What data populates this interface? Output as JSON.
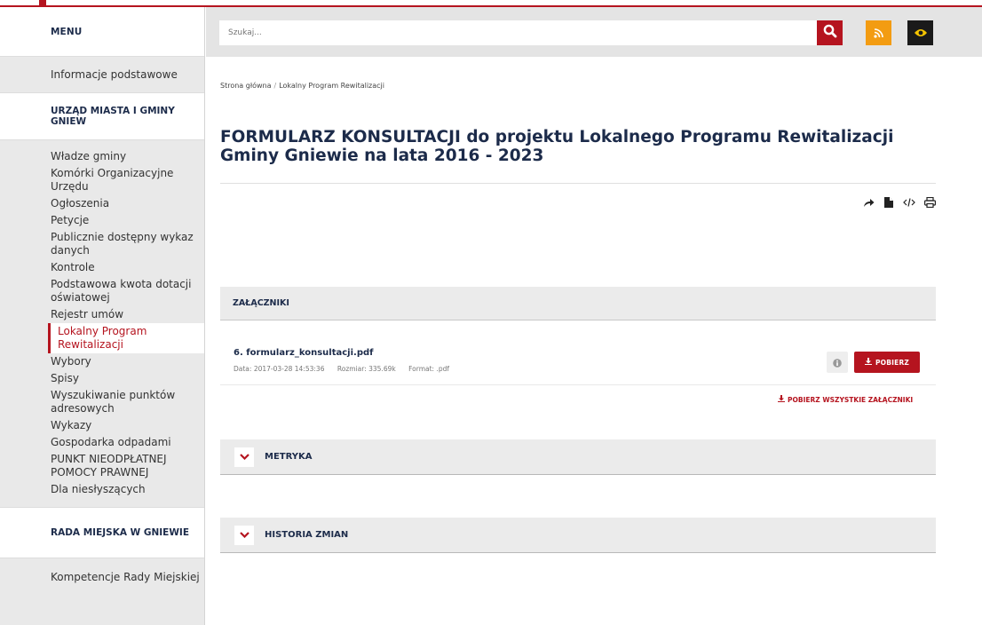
{
  "sidebar": {
    "menu_label": "MENU",
    "top_item": "Informacje podstawowe",
    "section1_title": "URZĄD MIASTA I GMINY GNIEW",
    "items": [
      "Władze gminy",
      "Komórki Organizacyjne Urzędu",
      "Ogłoszenia",
      "Petycje",
      "Publicznie dostępny wykaz danych",
      "Kontrole",
      "Podstawowa kwota dotacji oświatowej",
      "Rejestr umów",
      "Lokalny Program Rewitalizacji",
      "Wybory",
      "Spisy",
      "Wyszukiwanie punktów adresowych",
      "Wykazy",
      "Gospodarka odpadami",
      "PUNKT NIEODPŁATNEJ POMOCY PRAWNEJ",
      "Dla niesłyszących"
    ],
    "section2_title": "RADA MIEJSKA W GNIEWIE",
    "bottom_item": "Kompetencje Rady Miejskiej"
  },
  "search": {
    "placeholder": "Szukaj..."
  },
  "icons": {
    "search": "search-icon",
    "rss": "rss-icon",
    "eye": "eye-icon",
    "share": "share-icon",
    "document": "document-icon",
    "code": "code-icon",
    "print": "print-icon",
    "info": "info-icon",
    "download": "download-icon",
    "chevron": "chevron-down-icon"
  },
  "breadcrumb": {
    "home": "Strona główna",
    "separator": "/",
    "current": "Lokalny Program Rewitalizacji"
  },
  "page": {
    "title": "FORMULARZ KONSULTACJI do projektu Lokalnego Programu Rewitalizacji Gminy Gniewie na lata 2016 - 2023"
  },
  "attachments": {
    "header": "ZAŁĄCZNIKI",
    "file": {
      "name": "6. formularz_konsultacji.pdf",
      "date": "Data: 2017-03-28 14:53:36",
      "size": "Rozmiar: 335.69k",
      "format": "Format: .pdf"
    },
    "download_label": "POBIERZ",
    "download_all_label": "POBIERZ WSZYSTKIE ZAŁĄCZNIKI"
  },
  "accordions": {
    "metryka": "METRYKA",
    "historia": "HISTORIA ZMIAN"
  },
  "colors": {
    "accent": "#b5141f",
    "rss": "#f39c12",
    "eye_bg": "#1a1a1a",
    "eye_fg": "#f5c400",
    "title": "#1c2b4a"
  }
}
